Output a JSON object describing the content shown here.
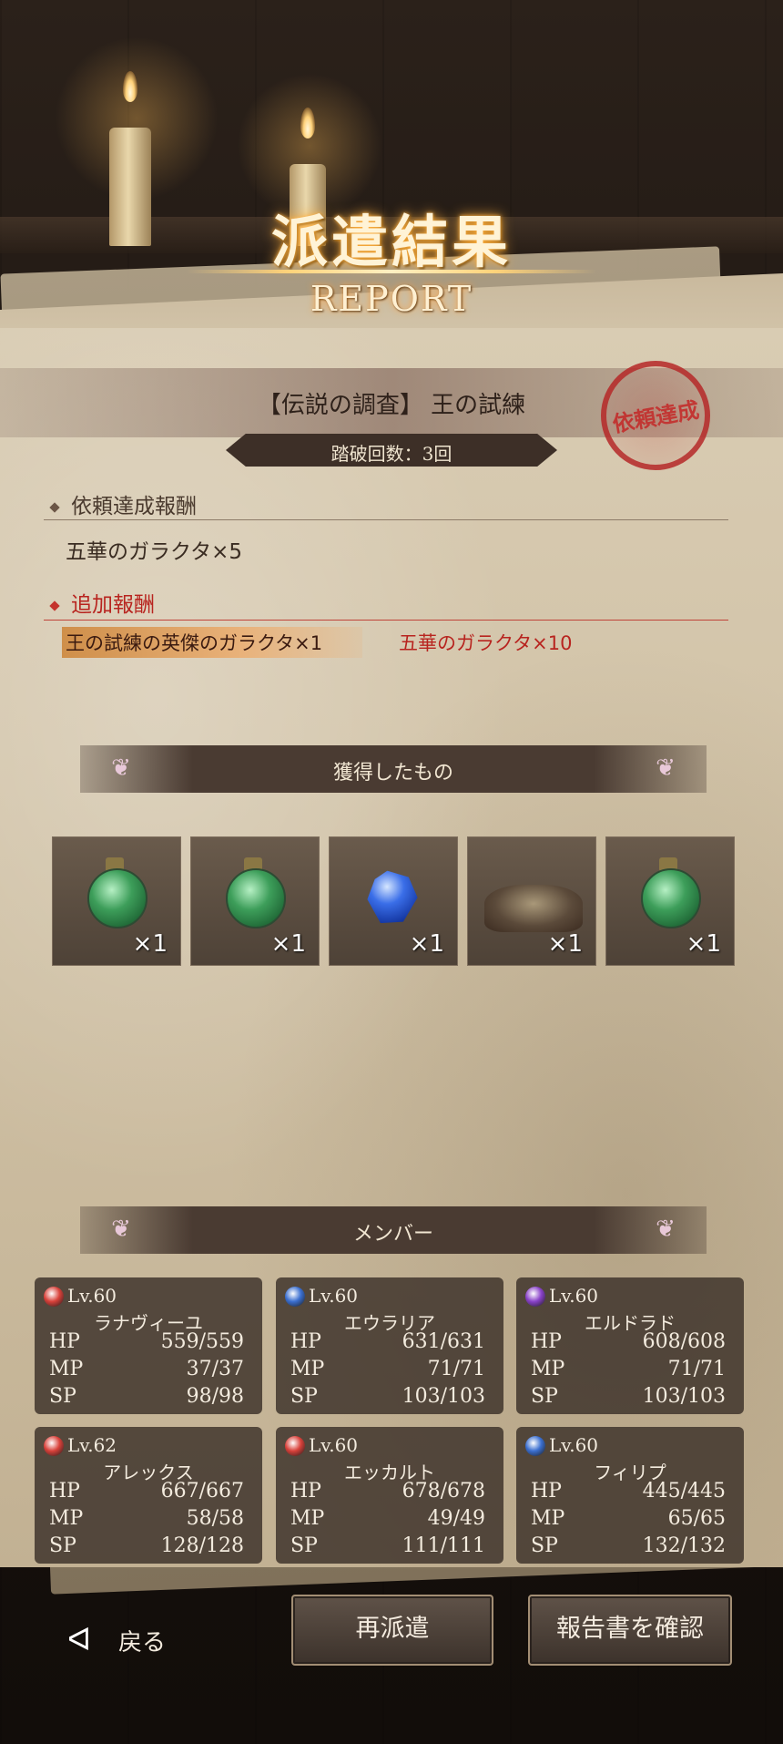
{
  "header": {
    "title_jp": "派遣結果",
    "title_en": "REPORT"
  },
  "quest": {
    "name": "【伝説の調査】 王の試練",
    "clear_count": "踏破回数：3回",
    "stamp": "依頼達成"
  },
  "rewards": {
    "base_heading": "依頼達成報酬",
    "base_item": "五華のガラクタ×5",
    "extra_heading": "追加報酬",
    "extra_items": [
      "王の試練の英傑のガラクタ×1",
      "五華のガラクタ×10"
    ]
  },
  "obtained": {
    "heading": "獲得したもの",
    "items": [
      {
        "icon": "green-potion-icon",
        "qty": "×1"
      },
      {
        "icon": "green-potion-icon",
        "qty": "×1"
      },
      {
        "icon": "blue-gem-icon",
        "qty": "×1"
      },
      {
        "icon": "junk-pile-icon",
        "qty": "×1"
      },
      {
        "icon": "green-potion-icon",
        "qty": "×1"
      }
    ]
  },
  "members": {
    "heading": "メンバー",
    "list": [
      {
        "element": "fire",
        "color": "#d9413a",
        "lv": "Lv.60",
        "name": "ラナヴィーユ",
        "hp": "559/559",
        "mp": "37/37",
        "sp": "98/98"
      },
      {
        "element": "water",
        "color": "#3b6fd0",
        "lv": "Lv.60",
        "name": "エウラリア",
        "hp": "631/631",
        "mp": "71/71",
        "sp": "103/103"
      },
      {
        "element": "dark",
        "color": "#8a42c9",
        "lv": "Lv.60",
        "name": "エルドラド",
        "hp": "608/608",
        "mp": "71/71",
        "sp": "103/103"
      },
      {
        "element": "fire",
        "color": "#d9413a",
        "lv": "Lv.62",
        "name": "アレックス",
        "hp": "667/667",
        "mp": "58/58",
        "sp": "128/128"
      },
      {
        "element": "fire",
        "color": "#d9413a",
        "lv": "Lv.60",
        "name": "エッカルト",
        "hp": "678/678",
        "mp": "49/49",
        "sp": "111/111"
      },
      {
        "element": "water",
        "color": "#3b6fd0",
        "lv": "Lv.60",
        "name": "フィリプ",
        "hp": "445/445",
        "mp": "65/65",
        "sp": "132/132"
      }
    ],
    "stat_labels": {
      "hp": "HP",
      "mp": "MP",
      "sp": "SP"
    }
  },
  "footer": {
    "back": "戻る",
    "redispatch": "再派遣",
    "check_report": "報告書を確認"
  },
  "colors": {
    "accent_red": "#c42424",
    "extra_red": "#b8241f"
  }
}
